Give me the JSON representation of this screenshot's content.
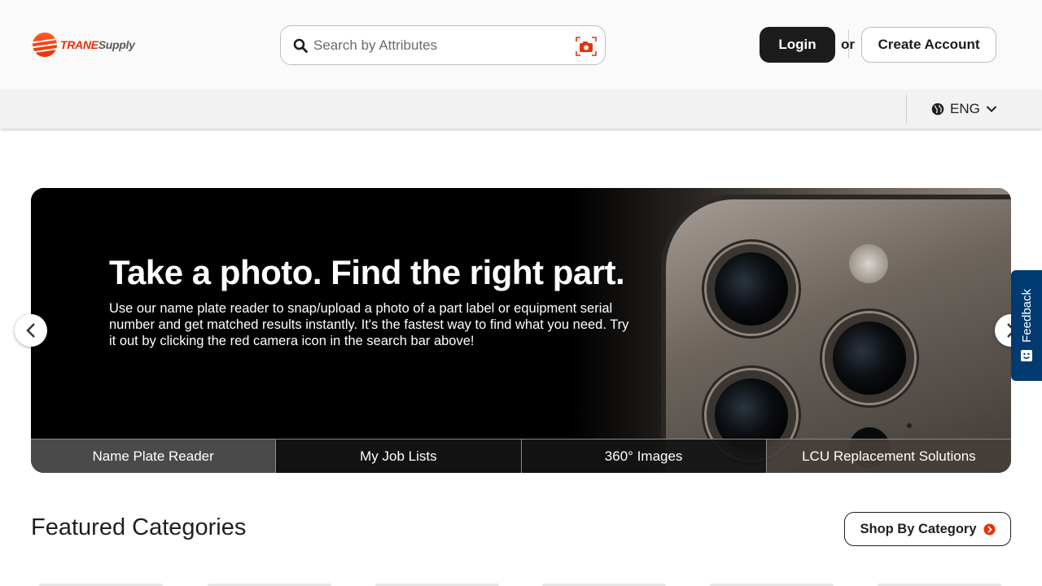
{
  "brand": {
    "name_part1": "TRANE",
    "name_part2": "Supply",
    "accent": "#e8320c"
  },
  "search": {
    "placeholder": "Search by Attributes",
    "icon": "search-icon",
    "camera_icon": "camera-icon"
  },
  "auth": {
    "login_label": "Login",
    "or_label": "or",
    "create_label": "Create Account"
  },
  "language": {
    "icon": "globe-icon",
    "label": "ENG"
  },
  "hero": {
    "title": "Take a photo. Find the right part.",
    "description": "Use our name plate reader to snap/upload a photo of a part label or equipment serial number and get matched results instantly. It's the fastest way to find what you need. Try it out by clicking the red camera icon in the search bar above!",
    "tabs": [
      {
        "label": "Name Plate Reader"
      },
      {
        "label": "My Job Lists"
      },
      {
        "label": "360° Images"
      },
      {
        "label": "LCU Replacement Solutions"
      }
    ]
  },
  "feedback": {
    "label": "Feedback"
  },
  "featured": {
    "title": "Featured Categories",
    "shop_label": "Shop By Category"
  }
}
